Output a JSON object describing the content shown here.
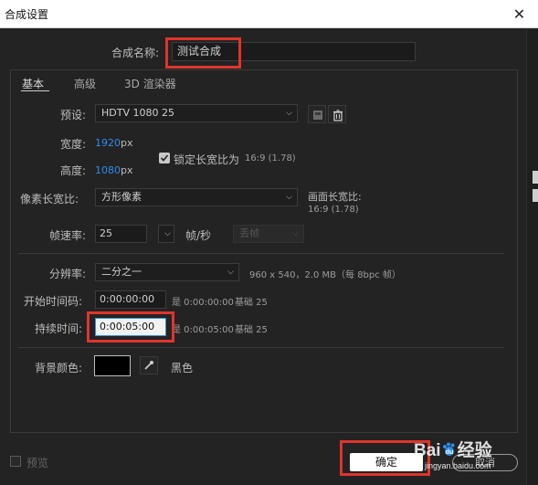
{
  "window": {
    "title": "合成设置",
    "close_icon": "close-icon"
  },
  "name_row": {
    "label": "合成名称:",
    "value": "测试合成"
  },
  "tabs": [
    "基本",
    "高级",
    "3D 渲染器"
  ],
  "preset": {
    "label": "预设:",
    "value": "HDTV 1080 25"
  },
  "width": {
    "label": "宽度:",
    "value": "1920",
    "unit": "px"
  },
  "height": {
    "label": "高度:",
    "value": "1080",
    "unit": "px"
  },
  "lock_aspect": {
    "label": "锁定长宽比为",
    "ratio": "16:9 (1.78)",
    "checked": true
  },
  "pixel_aspect": {
    "label": "像素长宽比:",
    "value": "方形像素"
  },
  "frame_aspect": {
    "label": "画面长宽比:",
    "value": "16:9 (1.78)"
  },
  "frame_rate": {
    "label": "帧速率:",
    "value": "25",
    "unit": "帧/秒",
    "drop_frame": "丢帧"
  },
  "resolution": {
    "label": "分辨率:",
    "value": "二分之一",
    "info": "960 x 540，2.0 MB（每 8bpc 帧）"
  },
  "start_timecode": {
    "label": "开始时间码:",
    "value": "0:00:00:00",
    "is_text": "是 0:00:00:00",
    "base_text": "基础 25"
  },
  "duration": {
    "label": "持续时间:",
    "value": "0:00:05:00",
    "is_text": "是 0:00:05:00",
    "base_text": "基础 25"
  },
  "background": {
    "label": "背景颜色:",
    "color_name": "黑色",
    "color": "#000000"
  },
  "footer": {
    "preview_label": "预览",
    "ok_label": "确定",
    "cancel_label": "取消"
  },
  "watermark": {
    "brand_a": "Bai",
    "brand_b": "经验",
    "url": "jingyan.baidu.com"
  },
  "colors": {
    "accent_blue": "#2d8ceb",
    "highlight_red": "#e0342c"
  }
}
